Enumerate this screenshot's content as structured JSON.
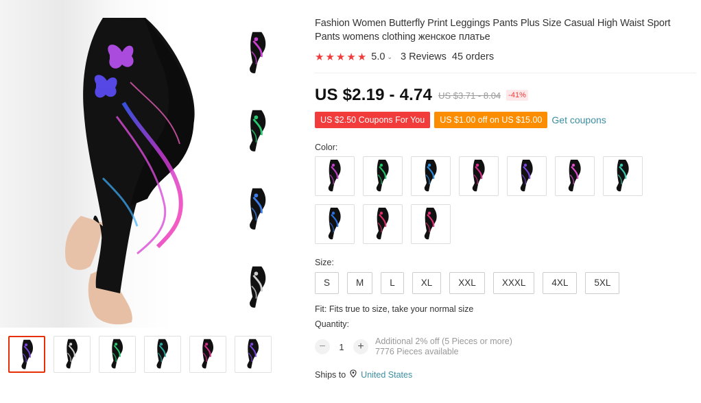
{
  "product": {
    "title": "Fashion Women Butterfly Print Leggings Pants Plus Size Casual High Waist Sport Pants womens clothing женское платье",
    "rating": "5.0",
    "reviews": "3 Reviews",
    "orders": "45 orders"
  },
  "price": {
    "current": "US $2.19 - 4.74",
    "original": "US $3.71 - 8.04",
    "discount": "-41%"
  },
  "coupons": {
    "coupon1": "US $2.50 Coupons For You",
    "coupon2": "US $1.00 off on US $15.00",
    "get": "Get coupons"
  },
  "color": {
    "label": "Color:",
    "options": [
      {
        "name": "black-purple",
        "accent": "#c040c8"
      },
      {
        "name": "black-green",
        "accent": "#23c46a"
      },
      {
        "name": "black-blue",
        "accent": "#2a8ee0"
      },
      {
        "name": "black-pink",
        "accent": "#d8308f"
      },
      {
        "name": "black-violet",
        "accent": "#7b47e0"
      },
      {
        "name": "black-magenta",
        "accent": "#e04fd0"
      },
      {
        "name": "black-teal",
        "accent": "#39c9b0"
      },
      {
        "name": "blue",
        "accent": "#2a72e0"
      },
      {
        "name": "rose",
        "accent": "#e0306a"
      },
      {
        "name": "red-pink",
        "accent": "#e02f78"
      }
    ]
  },
  "size": {
    "label": "Size:",
    "options": [
      "S",
      "M",
      "L",
      "XL",
      "XXL",
      "XXXL",
      "4XL",
      "5XL"
    ]
  },
  "fit": "Fit: Fits true to size, take your normal size",
  "quantity": {
    "label": "Quantity:",
    "value": "1",
    "minus": "−",
    "plus": "+",
    "note1": "Additional 2% off (5 Pieces or more)",
    "note2": "7776 Pieces available"
  },
  "shipping": {
    "label": "Ships to",
    "country": "United States"
  },
  "gallery": {
    "strip_accents": [
      "#c840d0",
      "#28c870",
      "#3f7de8",
      "#cfcfcf"
    ],
    "thumb_accents": [
      "#7b47e0",
      "#cfcfcf",
      "#28c870",
      "#2aa8a0",
      "#d8308f",
      "#7b47e0"
    ]
  },
  "colors": {
    "star": "#f23b3b",
    "coupon_red": "#f23b3b",
    "coupon_orange": "#fd8d00",
    "link": "#3b8ea0",
    "selected_border": "#e62e04"
  }
}
